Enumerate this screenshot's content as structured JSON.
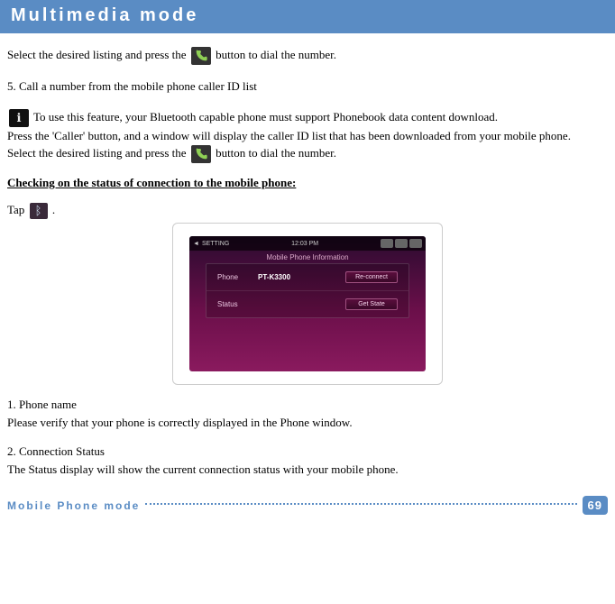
{
  "header": {
    "title": "Multimedia mode"
  },
  "intro": {
    "before": "Select the desired listing and press the ",
    "after": " button to dial the number."
  },
  "step5": {
    "title": "5. Call a number from the mobile phone caller ID list",
    "note": " To use this feature, your Bluetooth capable phone must support Phonebook data content download.",
    "line1": "Press the 'Caller' button, and a window will display the caller ID list that has been downloaded from your mobile phone.",
    "line2_before": "Select the desired listing and press the ",
    "line2_after": " button to dial the number."
  },
  "check_heading": "Checking on the status of connection to the mobile phone:",
  "tap": {
    "before": "Tap ",
    "after": " ."
  },
  "screen": {
    "topbar_label": "SETTING",
    "topbar_time": "12:03 PM",
    "title": "Mobile Phone Information",
    "row_phone_label": "Phone",
    "row_phone_value": "PT-K3300",
    "btn_reconnect": "Re-connect",
    "row_status_label": "Status",
    "btn_getstate": "Get State"
  },
  "item1": {
    "title": "1. Phone name",
    "body": "Please verify that your phone is correctly displayed in the Phone window."
  },
  "item2": {
    "title": "2. Connection Status",
    "body": "The Status display will show the current connection status with your mobile phone."
  },
  "footer": {
    "label": "Mobile Phone mode",
    "page": "69"
  }
}
